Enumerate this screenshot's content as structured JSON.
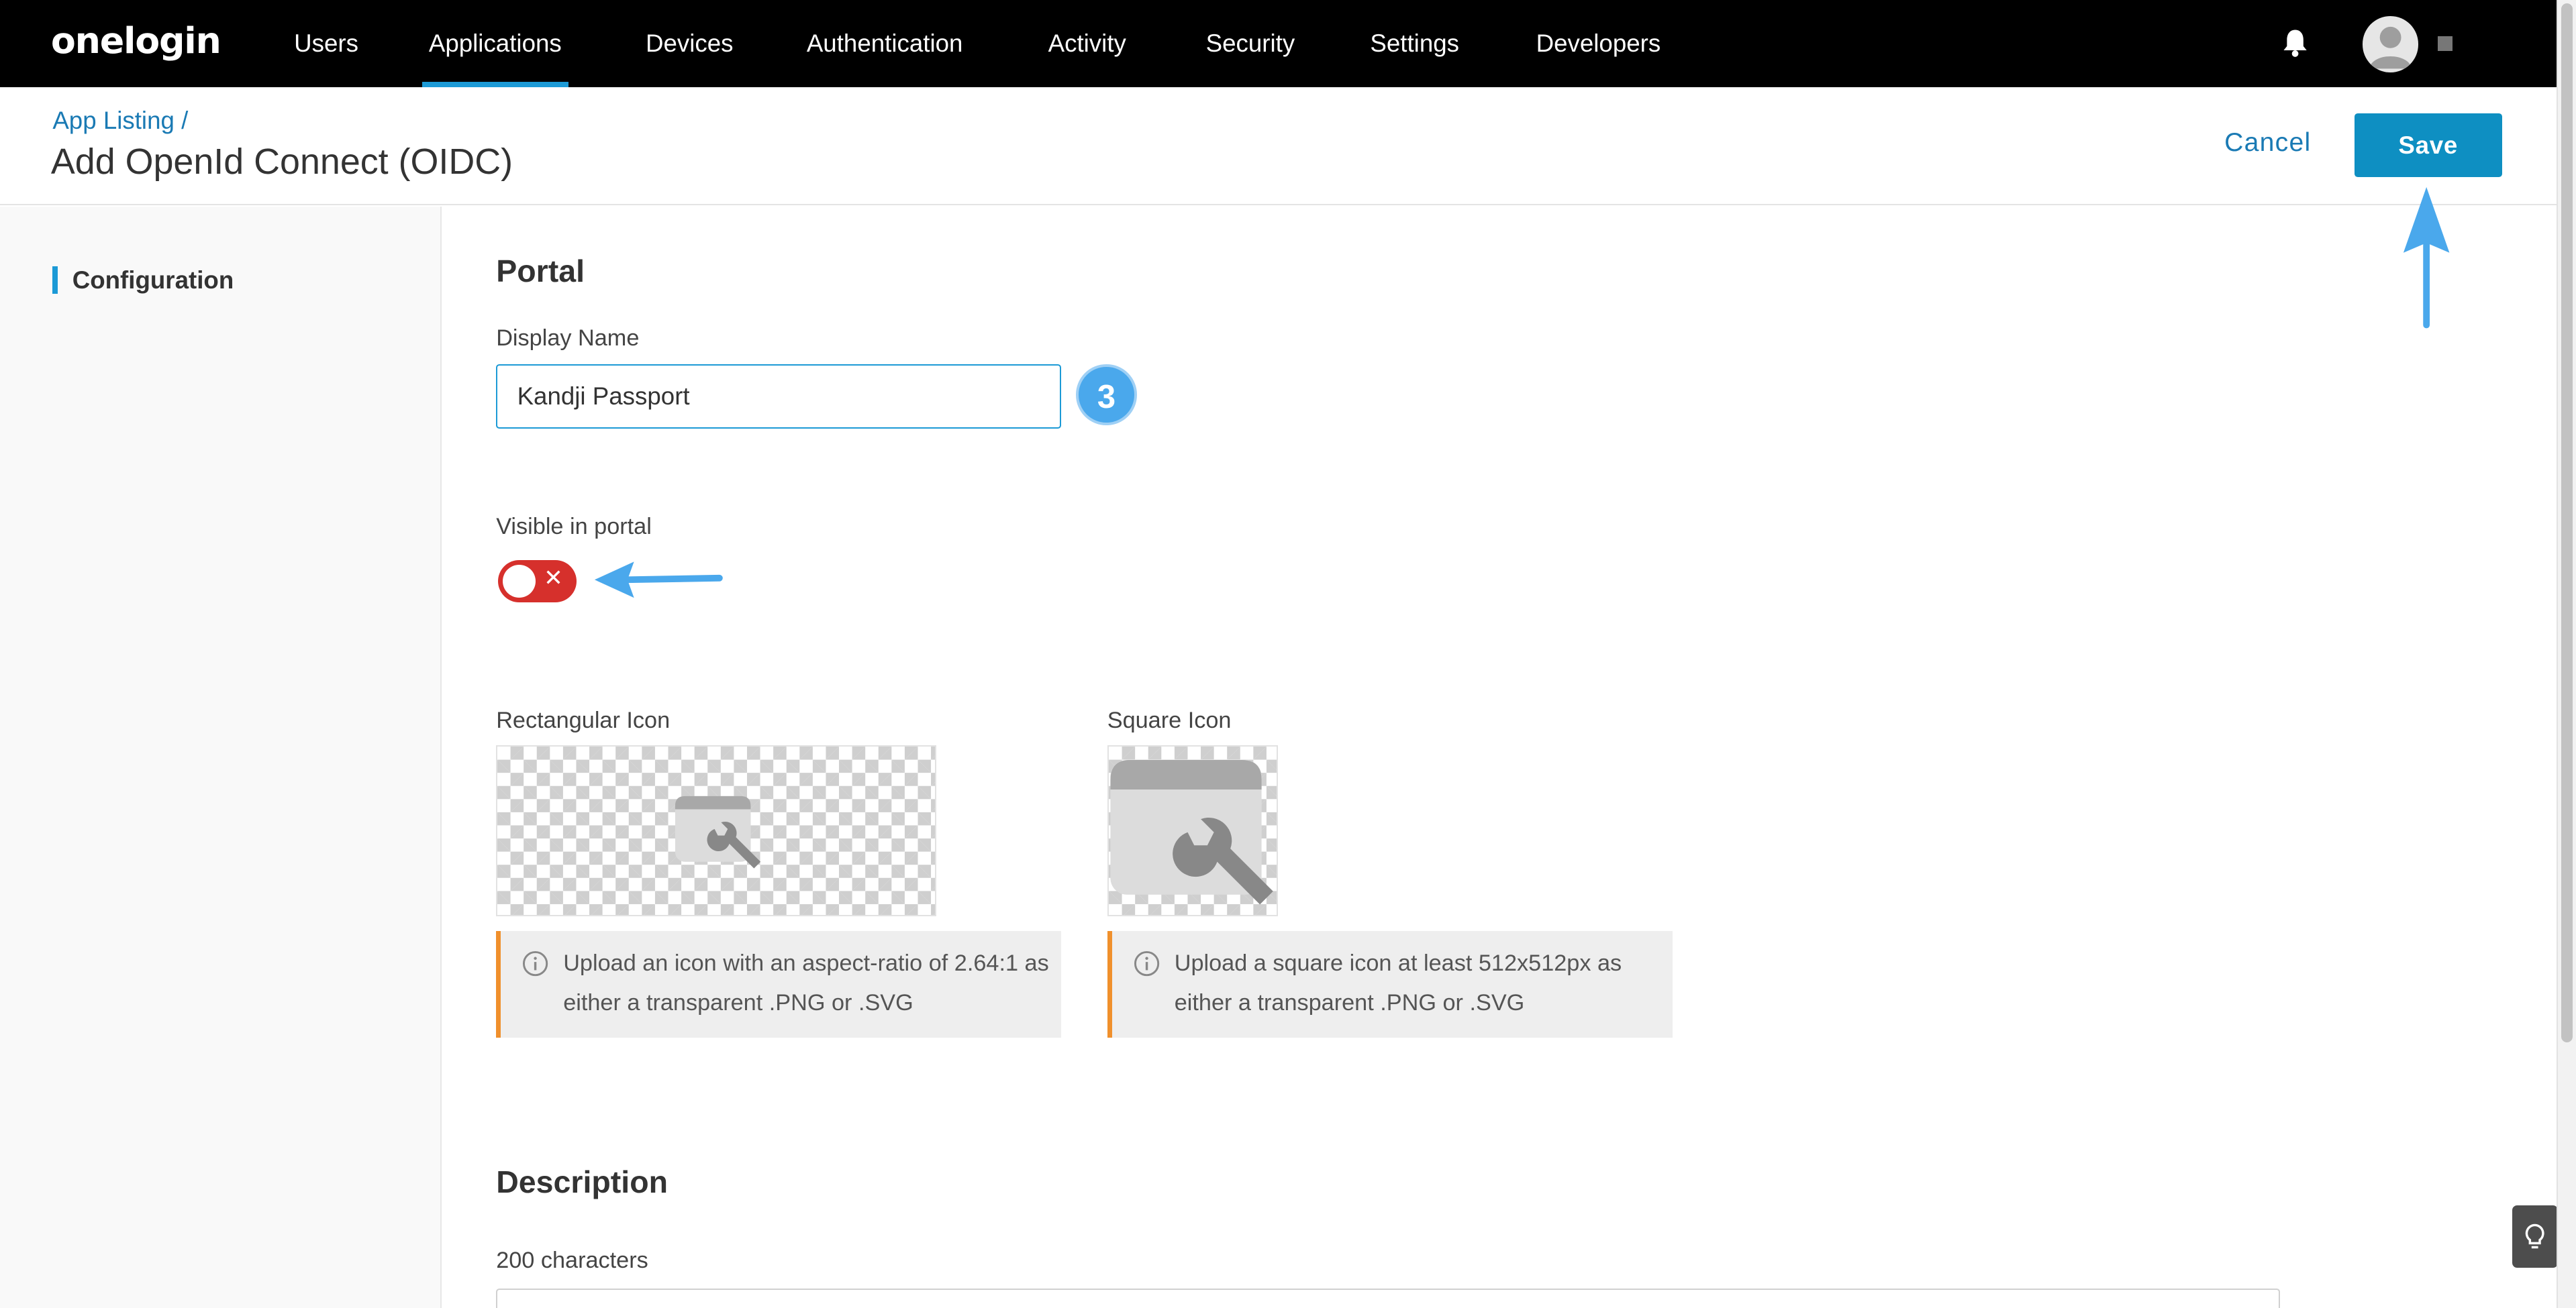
{
  "brand": {
    "logo": "onelogin"
  },
  "nav": {
    "items": [
      {
        "label": "Users"
      },
      {
        "label": "Applications"
      },
      {
        "label": "Devices"
      },
      {
        "label": "Authentication"
      },
      {
        "label": "Activity"
      },
      {
        "label": "Security"
      },
      {
        "label": "Settings"
      },
      {
        "label": "Developers"
      }
    ],
    "active": "Applications"
  },
  "header": {
    "breadcrumb": "App Listing /",
    "title": "Add OpenId Connect (OIDC)",
    "cancel_label": "Cancel",
    "save_label": "Save"
  },
  "sidebar": {
    "items": [
      {
        "label": "Configuration"
      }
    ]
  },
  "portal": {
    "title": "Portal",
    "display_name_label": "Display Name",
    "display_name_value": "Kandji Passport",
    "step_number": "3",
    "visible_label": "Visible in portal",
    "visible_state": "off",
    "visible_symbol": "✕",
    "rect_icon_label": "Rectangular Icon",
    "square_icon_label": "Square Icon",
    "rect_info": "Upload an icon with an aspect-ratio of 2.64:1 as either a transparent .PNG or .SVG",
    "square_info": "Upload a square icon at least 512x512px as either a transparent .PNG or .SVG"
  },
  "description": {
    "title": "Description",
    "counter": "200 characters"
  },
  "colors": {
    "accent": "#1c9ad6",
    "save_button": "#0e8fc2",
    "toggle_off": "#d6302c",
    "info_border": "#f0902c",
    "annotation": "#4aa8ec"
  },
  "icons": [
    "bell-icon",
    "avatar-icon",
    "info-icon",
    "wrench-icon",
    "lightbulb-icon",
    "arrow-icon"
  ]
}
